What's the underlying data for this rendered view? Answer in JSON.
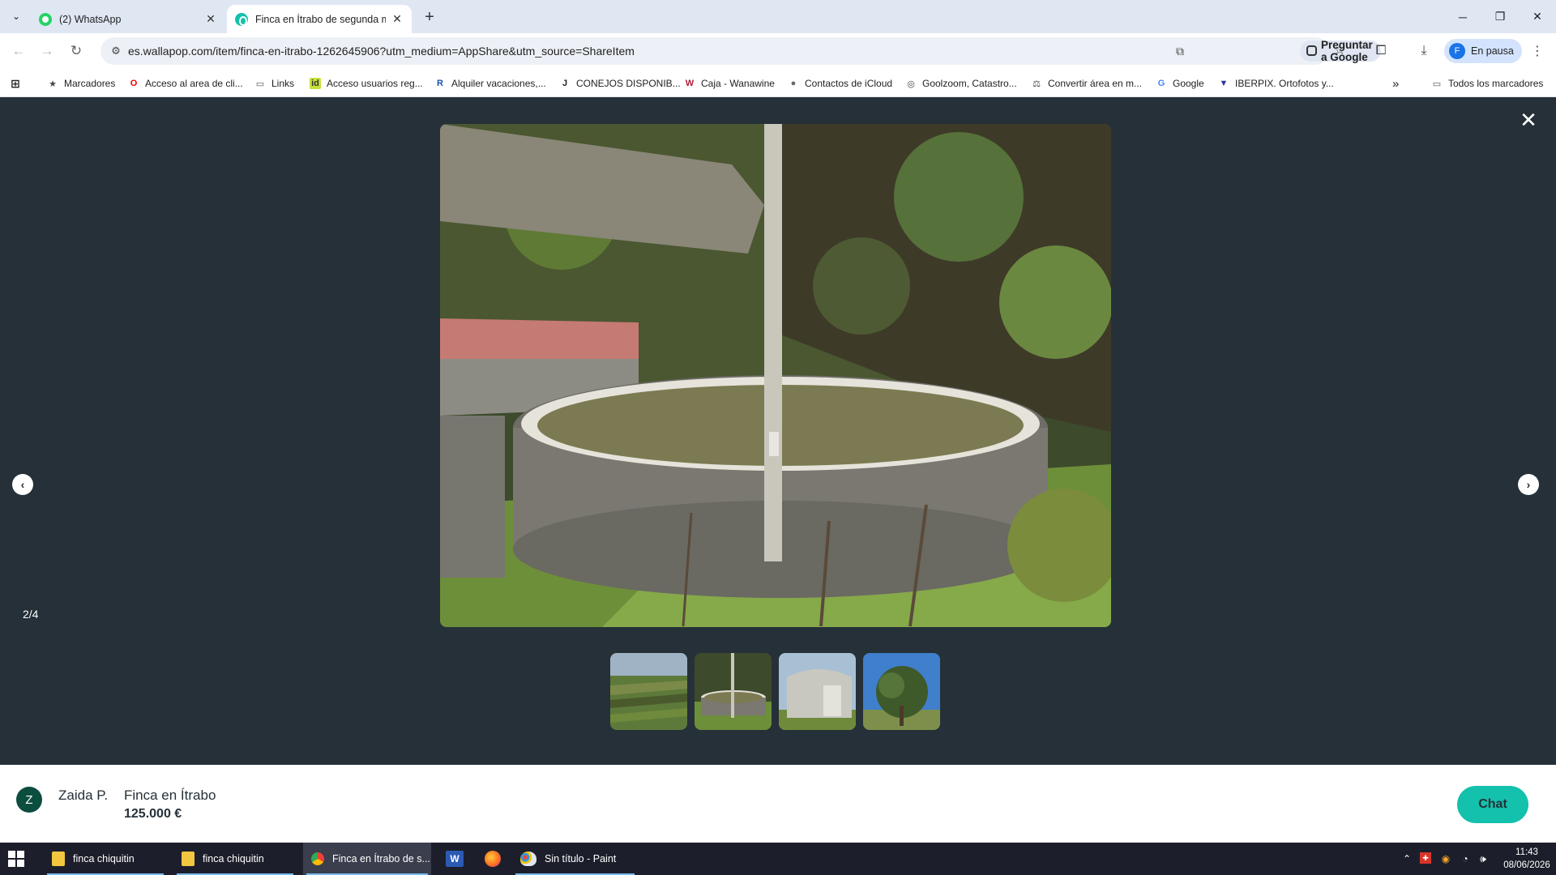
{
  "browser": {
    "tabs": [
      {
        "title": "(2) WhatsApp",
        "active": false
      },
      {
        "title": "Finca en Ítrabo de segunda mano",
        "active": true
      }
    ],
    "new_tab_label": "+",
    "address": "es.wallapop.com/item/finca-en-itrabo-1262645906?utm_medium=AppShare&utm_source=ShareItem",
    "ask_google_label": "Preguntar a Google",
    "profile_initial": "F",
    "profile_label": "En pausa"
  },
  "bookmarks": {
    "items": [
      {
        "label": "Marcadores",
        "icon": "star-icon"
      },
      {
        "label": "Acceso al area de cli...",
        "icon": "opera-icon"
      },
      {
        "label": "Links",
        "icon": "folder-icon"
      },
      {
        "label": "Acceso usuarios reg...",
        "icon": "idealista-icon"
      },
      {
        "label": "Alquiler vacaciones,...",
        "icon": "r-icon"
      },
      {
        "label": "CONEJOS DISPONIB...",
        "icon": "j-icon"
      },
      {
        "label": "Caja - Wanawine",
        "icon": "w-icon"
      },
      {
        "label": "Contactos de iCloud",
        "icon": "apple-icon"
      },
      {
        "label": "Goolzoom, Catastro...",
        "icon": "globe-icon"
      },
      {
        "label": "Convertir área en m...",
        "icon": "converter-icon"
      },
      {
        "label": "Google",
        "icon": "google-icon"
      },
      {
        "label": "IBERPIX. Ortofotos y...",
        "icon": "iberpix-icon"
      }
    ],
    "more_label": "»",
    "all_bookmarks_label": "Todos los marcadores"
  },
  "viewer": {
    "counter": "2/4",
    "thumbnail_count": 4
  },
  "listing": {
    "seller_initial": "Z",
    "seller_name": "Zaida P.",
    "title": "Finca en Ítrabo",
    "price": "125.000 €",
    "chat_label": "Chat"
  },
  "taskbar": {
    "items": [
      {
        "label": "finca chiquitin"
      },
      {
        "label": "finca chiquitin"
      },
      {
        "label": "Finca en Ítrabo de s..."
      },
      {
        "label": "Sin título - Paint"
      }
    ],
    "time": "11:43",
    "date": "08/06/2026"
  },
  "colors": {
    "viewer_bg": "#253038",
    "chat_button": "#13c1ac",
    "seller_avatar": "#0b4d3e"
  }
}
